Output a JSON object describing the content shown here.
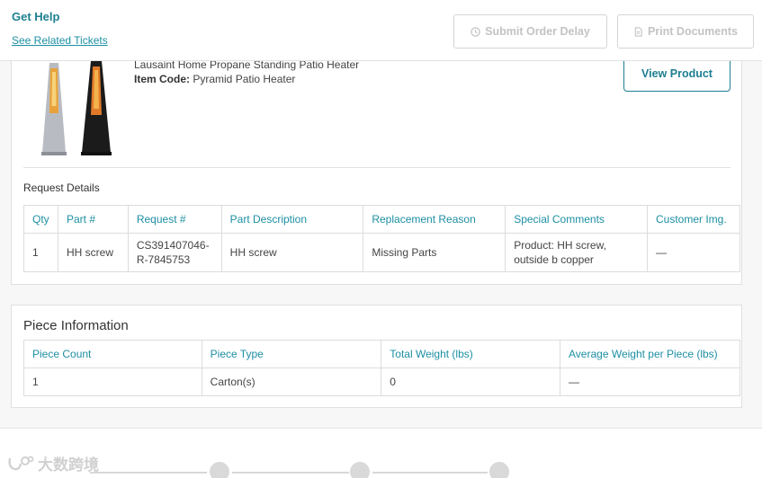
{
  "header": {
    "get_help": "Get Help",
    "related_link": "See Related Tickets",
    "submit_delay_label": "Submit Order Delay",
    "print_docs_label": "Print Documents"
  },
  "product": {
    "name": "Lausaint Home Propane Standing Patio Heater",
    "item_code_label": "Item Code:",
    "item_code_value": " Pyramid Patio Heater",
    "view_button": "View Product"
  },
  "request_details": {
    "title": "Request Details",
    "columns": [
      "Qty",
      "Part #",
      "Request #",
      "Part Description",
      "Replacement Reason",
      "Special Comments",
      "Customer Img."
    ],
    "rows": [
      [
        "1",
        "HH screw",
        "CS391407046-R-7845753",
        "HH screw",
        "Missing Parts",
        "Product: HH screw, outside b copper",
        "—"
      ]
    ]
  },
  "piece_information": {
    "title": "Piece Information",
    "columns": [
      "Piece Count",
      "Piece Type",
      "Total Weight (lbs)",
      "Average Weight per Piece (lbs)"
    ],
    "rows": [
      [
        "1",
        "Carton(s)",
        "0",
        "—"
      ]
    ]
  },
  "watermark": {
    "text": "大数跨境"
  },
  "colors": {
    "accent": "#1d7f91",
    "link": "#1d8fa3",
    "disabled": "#c3c3c3"
  }
}
